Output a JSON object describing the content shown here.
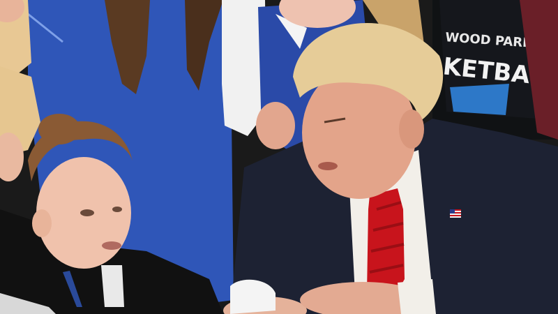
{
  "photo": {
    "shirt_line_1": "WOOD PARK",
    "shirt_line_2": "KETBALL",
    "colors": {
      "jersey_blue": "#2f56b8",
      "suit_navy": "#1d2233",
      "tie_red": "#c8141c",
      "shirt_white": "#f2efe9",
      "background_dark": "#151515",
      "skin": "#e8b8a0",
      "hair_blonde": "#e6c890"
    },
    "icons": [
      "flag-pin-icon"
    ]
  }
}
